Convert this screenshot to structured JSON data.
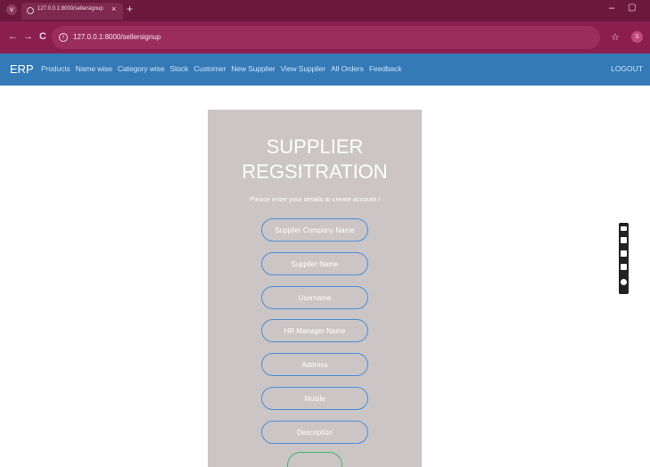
{
  "browser": {
    "tab_title": "127.0.0.1:8000/sellersignup",
    "tab_close": "×",
    "new_tab": "+",
    "menu_icon": "v",
    "minimize": "–",
    "restore": "▢",
    "back": "←",
    "forward": "→",
    "reload": "C",
    "info": "i",
    "url": "127.0.0.1:8000/sellersignup",
    "star": "☆",
    "profile": "S"
  },
  "navbar": {
    "brand": "ERP",
    "links": [
      "Products",
      "Name wise",
      "Category wise",
      "Stock",
      "Customer",
      "New Supplier",
      "View Supplier",
      "All Orders",
      "Feedback"
    ],
    "logout": "LOGOUT",
    "color": "#337ab7"
  },
  "form": {
    "title": "SUPPLIER REGSITRATION",
    "subtitle": "Please enter your details to create account !",
    "fields": [
      {
        "placeholder": "Supplier Company Name"
      },
      {
        "placeholder": "Supplier Name"
      },
      {
        "placeholder": "Username"
      },
      {
        "placeholder": "HR Manager Name"
      },
      {
        "placeholder": "Address"
      },
      {
        "placeholder": "Mobile"
      },
      {
        "placeholder": "Description"
      }
    ],
    "field_border_color": "#4a8fd8",
    "submit_border_color": "#3cb96a",
    "card_color": "#cbc5c5"
  },
  "extension_toolbar": {
    "icons": [
      "pen-icon",
      "camera-icon",
      "video-icon",
      "screen-icon",
      "settings-icon"
    ]
  }
}
